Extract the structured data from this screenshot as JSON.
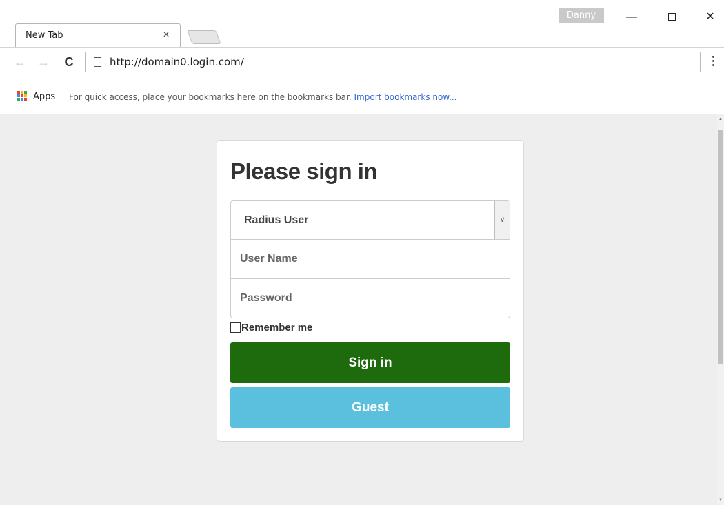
{
  "browser": {
    "tab_title": "New Tab",
    "tab_close_glyph": "×",
    "profile_name": "Danny",
    "minimize_glyph": "—",
    "close_glyph": "✕",
    "back_glyph": "←",
    "forward_glyph": "→",
    "reload_glyph": "C",
    "url": "http://domain0.login.com/"
  },
  "bookmarks_bar": {
    "apps_label": "Apps",
    "hint_text": "For quick access, place your bookmarks here on the bookmarks bar.",
    "import_link": "Import bookmarks now..."
  },
  "login": {
    "title": "Please sign in",
    "account_type_selected": "Radius User",
    "username_placeholder": "User Name",
    "password_placeholder": "Password",
    "remember_label": "Remember me",
    "signin_button": "Sign in",
    "guest_button": "Guest"
  },
  "colors": {
    "signin_button": "#1d6b0c",
    "guest_button": "#5bc0de",
    "page_background": "#eeeeee",
    "link": "#3367d6"
  }
}
